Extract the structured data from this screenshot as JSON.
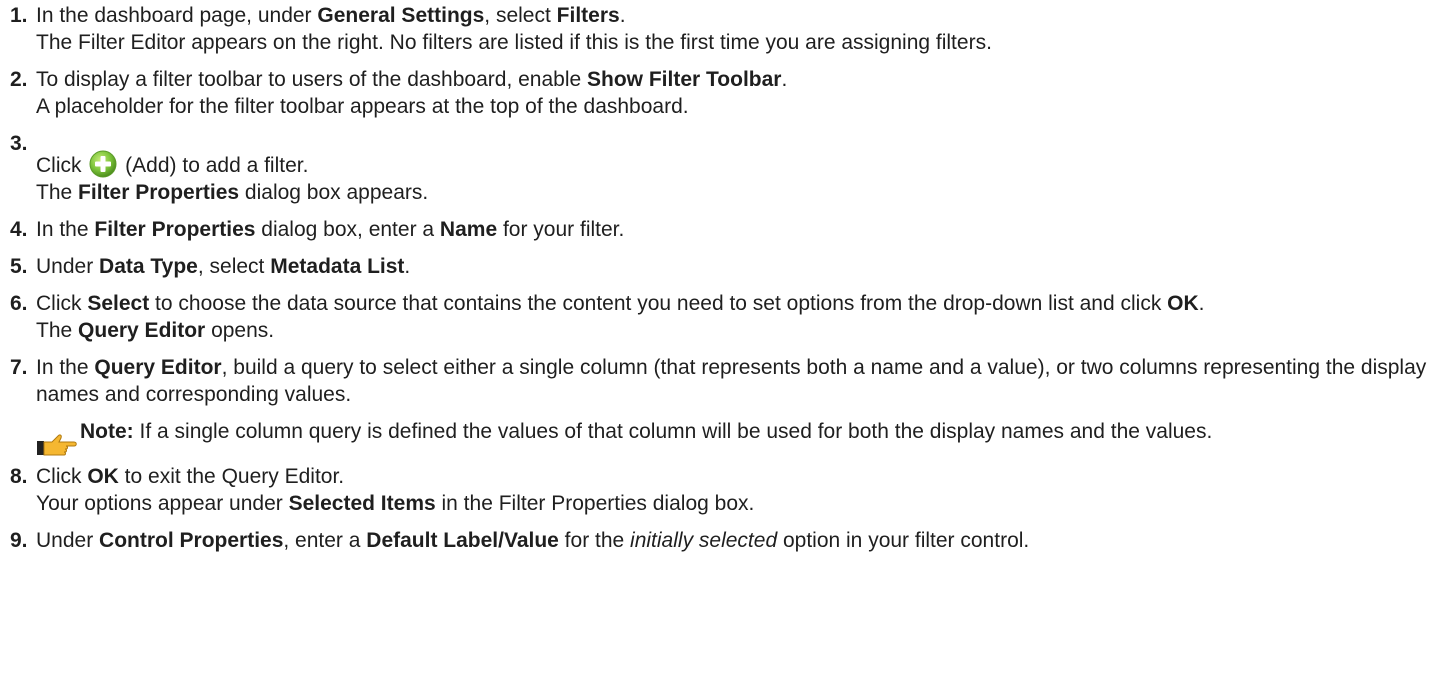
{
  "steps": [
    {
      "number": "1.",
      "parts": [
        {
          "t": "In the dashboard page, under "
        },
        {
          "t": "General Settings",
          "b": true
        },
        {
          "t": ", select "
        },
        {
          "t": "Filters",
          "b": true
        },
        {
          "t": "."
        }
      ],
      "result": [
        {
          "t": "The Filter Editor appears on the right. No filters are listed if this is the first time you are assigning filters."
        }
      ]
    },
    {
      "number": "2.",
      "parts": [
        {
          "t": "To display a filter toolbar to users of the dashboard, enable "
        },
        {
          "t": "Show Filter Toolbar",
          "b": true
        },
        {
          "t": "."
        }
      ],
      "result": [
        {
          "t": "A placeholder for the filter toolbar appears at the top of the dashboard."
        }
      ]
    },
    {
      "number": "3.",
      "before_icon": "Click ",
      "icon": "add-icon",
      "after_icon": " (Add) to add a filter.",
      "result": [
        {
          "t": "The "
        },
        {
          "t": "Filter Properties",
          "b": true
        },
        {
          "t": " dialog box appears."
        }
      ]
    },
    {
      "number": "4.",
      "parts": [
        {
          "t": "In the "
        },
        {
          "t": "Filter Properties",
          "b": true
        },
        {
          "t": " dialog box, enter a "
        },
        {
          "t": "Name",
          "b": true
        },
        {
          "t": " for your filter."
        }
      ]
    },
    {
      "number": "5.",
      "parts": [
        {
          "t": "Under "
        },
        {
          "t": "Data Type",
          "b": true
        },
        {
          "t": ", select "
        },
        {
          "t": "Metadata List",
          "b": true
        },
        {
          "t": "."
        }
      ]
    },
    {
      "number": "6.",
      "parts": [
        {
          "t": "Click "
        },
        {
          "t": "Select",
          "b": true
        },
        {
          "t": " to choose the data source that contains the content you need to set options from the drop-down list and click "
        },
        {
          "t": "OK",
          "b": true
        },
        {
          "t": "."
        }
      ],
      "result": [
        {
          "t": "The "
        },
        {
          "t": "Query Editor",
          "b": true
        },
        {
          "t": " opens."
        }
      ]
    },
    {
      "number": "7.",
      "parts": [
        {
          "t": "In the "
        },
        {
          "t": "Query Editor",
          "b": true
        },
        {
          "t": ", build a query to select either a single column (that represents both a name and a value), or two columns representing the display names and corresponding values."
        }
      ],
      "note": {
        "icon": "pointing-hand-icon",
        "label": "Note:",
        "text": " If a single column query is defined the values of that column will be used for both the display names and the values."
      }
    },
    {
      "number": "8.",
      "parts": [
        {
          "t": "Click "
        },
        {
          "t": "OK",
          "b": true
        },
        {
          "t": " to exit the Query Editor."
        }
      ],
      "result": [
        {
          "t": "Your options appear under "
        },
        {
          "t": "Selected Items",
          "b": true
        },
        {
          "t": " in the Filter Properties dialog box."
        }
      ]
    },
    {
      "number": "9.",
      "parts": [
        {
          "t": "Under "
        },
        {
          "t": "Control Properties",
          "b": true
        },
        {
          "t": ", enter a "
        },
        {
          "t": "Default Label/Value",
          "b": true
        },
        {
          "t": " for the "
        },
        {
          "t": "initially selected",
          "i": true
        },
        {
          "t": "  option in your filter control."
        }
      ]
    }
  ],
  "colors": {
    "text": "#1f1f1f",
    "add_icon_green": "#7cc43a",
    "note_hand": "#f5b731"
  }
}
